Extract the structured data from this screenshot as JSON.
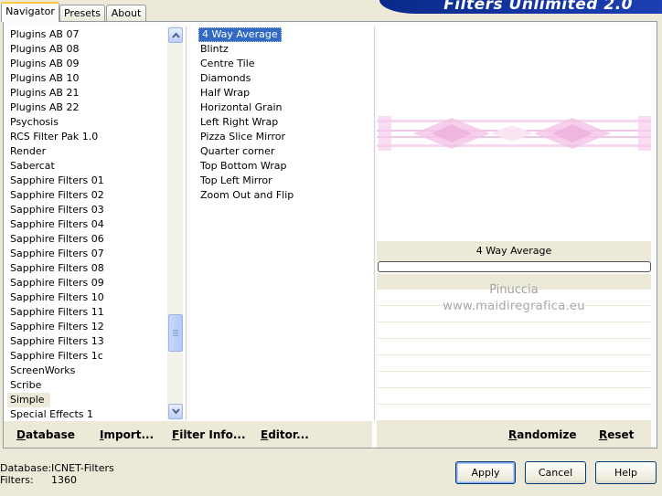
{
  "tabs": [
    "Navigator",
    "Presets",
    "About"
  ],
  "title": "Filters Unlimited 2.0",
  "categories": [
    "Plugins AB 07",
    "Plugins AB 08",
    "Plugins AB 09",
    "Plugins AB 10",
    "Plugins AB 21",
    "Plugins AB 22",
    "Psychosis",
    "RCS Filter Pak 1.0",
    "Render",
    "Sabercat",
    "Sapphire Filters 01",
    "Sapphire Filters 02",
    "Sapphire Filters 03",
    "Sapphire Filters 04",
    "Sapphire Filters 06",
    "Sapphire Filters 07",
    "Sapphire Filters 08",
    "Sapphire Filters 09",
    "Sapphire Filters 10",
    "Sapphire Filters 11",
    "Sapphire Filters 12",
    "Sapphire Filters 13",
    "Sapphire Filters 1c",
    "ScreenWorks",
    "Scribe",
    "Simple",
    "Special Effects 1"
  ],
  "selected_category": "Simple",
  "filters": [
    "4 Way Average",
    "Blintz",
    "Centre Tile",
    "Diamonds",
    "Half Wrap",
    "Horizontal Grain",
    "Left Right Wrap",
    "Pizza Slice Mirror",
    "Quarter corner",
    "Top Bottom Wrap",
    "Top Left Mirror",
    "Zoom Out and Flip"
  ],
  "selected_filter": "4 Way Average",
  "preview_name": "4 Way Average",
  "watermark": {
    "line1": "Pinuccia",
    "line2": "www.maidiregrafica.eu"
  },
  "left_actions": {
    "database": "Database",
    "import": "Import...",
    "filter_info": "Filter Info...",
    "editor": "Editor..."
  },
  "right_actions": {
    "randomize": "Randomize",
    "reset": "Reset"
  },
  "info": {
    "database_label": "Database:",
    "database_value": "ICNET-Filters",
    "filters_label": "Filters:",
    "filters_value": "1360"
  },
  "buttons": {
    "apply": "Apply",
    "cancel": "Cancel",
    "help": "Help"
  },
  "colors": {
    "selection": "#316ac5",
    "banner": "#0a2a8a",
    "face": "#ece9d8"
  }
}
